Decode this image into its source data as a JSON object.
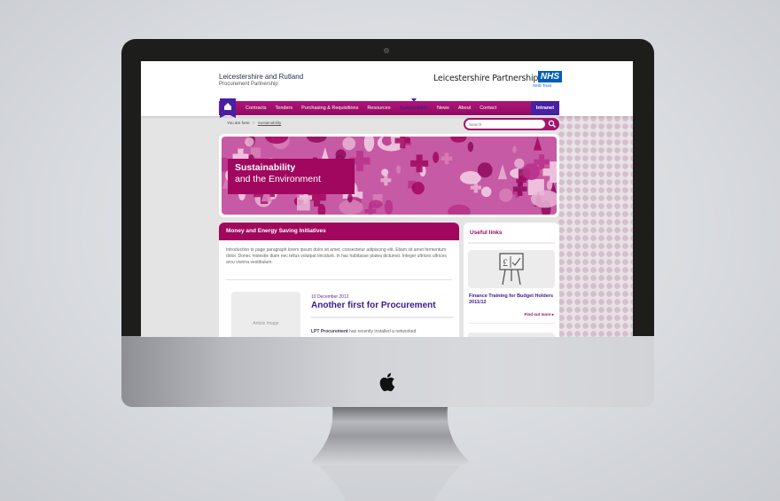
{
  "device": {
    "type": "iMac",
    "logo": "apple-logo-icon"
  },
  "header": {
    "org_name_line1": "Leicestershire and Rutland",
    "org_name_line2": "Procurement Partnership",
    "partner_name": "Leicestershire Partnership",
    "partner_badge": "NHS",
    "partner_sub": "NHS Trust"
  },
  "nav": {
    "home_icon": "home-icon",
    "items": [
      {
        "label": "Contracts",
        "active": false
      },
      {
        "label": "Tenders",
        "active": false
      },
      {
        "label": "Purchasing & Requisitions",
        "active": false
      },
      {
        "label": "Resources",
        "active": false
      },
      {
        "label": "Sustainability",
        "active": true
      },
      {
        "label": "News",
        "active": false
      },
      {
        "label": "About",
        "active": false
      },
      {
        "label": "Contact",
        "active": false
      }
    ],
    "intranet_label": "Intranet"
  },
  "breadcrumb": {
    "prefix": "You are here",
    "separator": ">",
    "current": "Sustainability"
  },
  "search": {
    "placeholder": "Search",
    "value": "",
    "icon": "search-icon"
  },
  "banner": {
    "title": "Sustainability",
    "subtitle": "and the Environment"
  },
  "main_panel": {
    "heading": "Money and Energy Saving Initiatives",
    "intro": "Introduction to page paragraph lorem ipsum dolor sit amet, consectetur adipiscing elit. Etiam sit amet fermentum dolor. Donec molestie diam nec tellus volutpat tincidunt. In hac habitasse platea dictumst. Integer ultrices ultrices arcu viverra vestibulum.",
    "article": {
      "image_placeholder": "Article Image",
      "date": "10 December 2012",
      "title": "Another first for Procurement",
      "body_bold": "LPT Procurement",
      "body_rest": " has recently installed a networked"
    }
  },
  "sidebar": {
    "heading": "Useful links",
    "card_icon": "presentation-board-icon",
    "link_title": "Finance Training for Budget Holders 2011/12",
    "more_label": "Find out more ▸"
  },
  "colors": {
    "brand_magenta": "#a1075f",
    "brand_purple": "#4a1fa3",
    "link_purple": "#3a1a90",
    "nhs_blue": "#005eb8",
    "banner_pink": "#c75aa4"
  }
}
